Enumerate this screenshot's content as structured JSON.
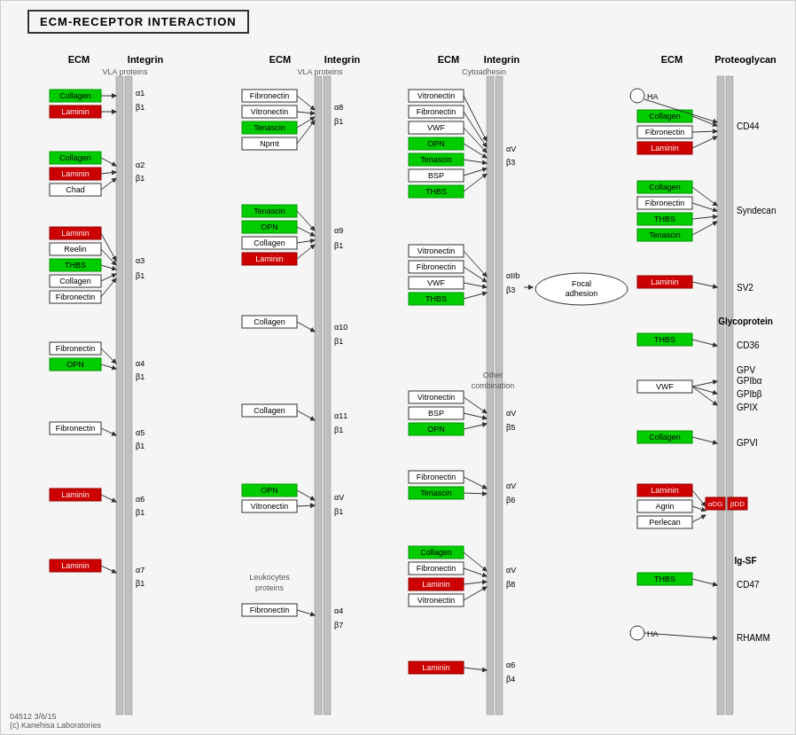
{
  "title": "ECM-RECEPTOR INTERACTION",
  "footer": {
    "line1": "04512 3/6/15",
    "line2": "(c) Kanehisa Laboratories"
  },
  "sections": [
    {
      "id": "section1",
      "ecm_label": "ECM",
      "integrin_label": "Integrin",
      "subtype": "VLA proteins"
    },
    {
      "id": "section2",
      "ecm_label": "ECM",
      "integrin_label": "Integrin",
      "subtype": "VLA proteins"
    },
    {
      "id": "section3",
      "ecm_label": "ECM",
      "integrin_label": "Integrin",
      "subtype": "Cytoadhesin"
    },
    {
      "id": "section4",
      "ecm_label": "ECM",
      "integrin_label": "Proteoglycan"
    }
  ],
  "focal_adhesion_label": "Focal adhesion",
  "nodes": {
    "collagen": "Collagen",
    "laminin": "Laminin",
    "fibronectin": "Fibronectin",
    "vitronectin": "Vitronectin",
    "tenascin": "Tenascin",
    "opn": "OPN",
    "thbs": "THBS",
    "vwf": "VWF",
    "bsp": "BSP",
    "reelin": "Reelin",
    "chad": "Chad",
    "npnt": "Npmt",
    "agrin": "Agrin",
    "perlecan": "Perlecan",
    "ha": "HA",
    "cd44": "CD44",
    "syndecan": "Syndecan",
    "sv2": "SV2",
    "cd36": "CD36",
    "gpv": "GPV",
    "gpiba": "GPIbα",
    "gpibb": "GPIbβ",
    "gpix": "GPIX",
    "gpvi": "GPVI",
    "cd47": "CD47",
    "rhamm": "RHAMM"
  }
}
